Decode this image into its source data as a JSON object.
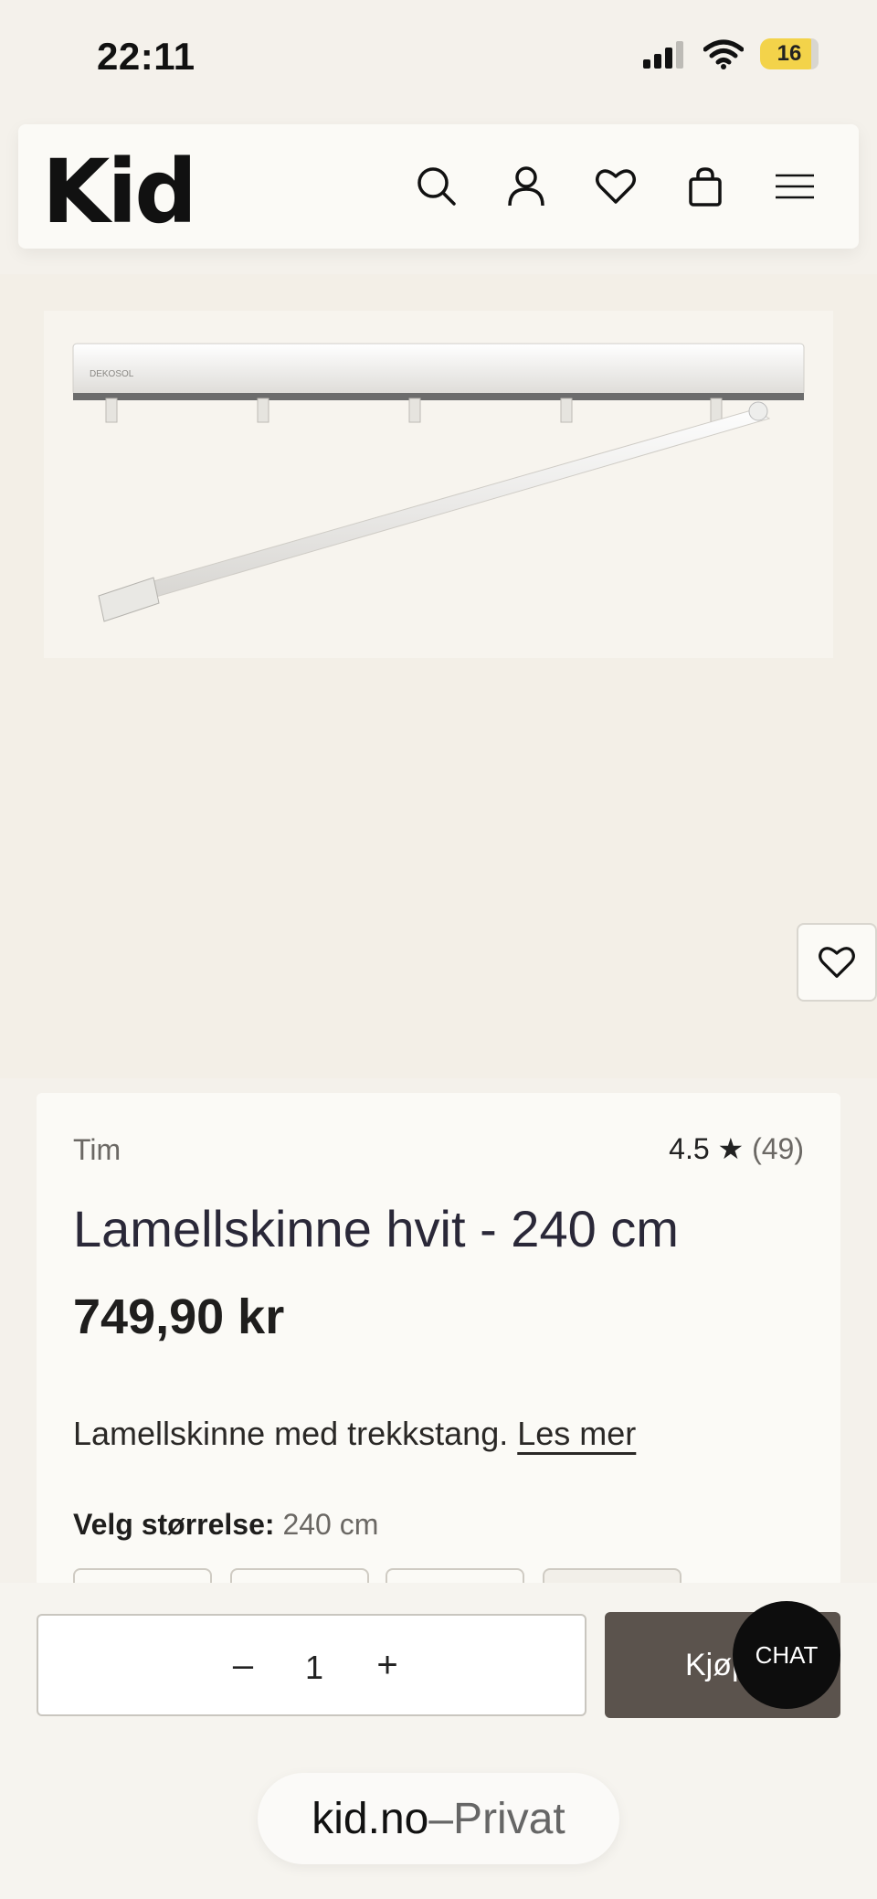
{
  "status": {
    "time": "22:11",
    "battery": "16"
  },
  "header": {
    "logo": "Kid"
  },
  "product": {
    "brand": "Tim",
    "rating": "4.5 ★",
    "rating_count": "(49)",
    "title": "Lamellskinne hvit - 240 cm",
    "price": "749,90 kr",
    "description": "Lamellskinne med trekkstang.",
    "read_more": "Les mer",
    "size_label": "Velg størrelse:",
    "size_value": "240 cm",
    "image_brand_text": "DEKOSOL"
  },
  "cart": {
    "quantity": "1",
    "minus": "–",
    "plus": "+",
    "buy_label": "Kjøp"
  },
  "chat": {
    "label": "CHAT"
  },
  "browser": {
    "domain": "kid.no",
    "separator": " – ",
    "mode": "Privat"
  },
  "colors": {
    "buy_button": "#5b534d",
    "chat_button": "#0d0d0d",
    "battery": "#f3d34a",
    "background": "#f4f1eb"
  }
}
